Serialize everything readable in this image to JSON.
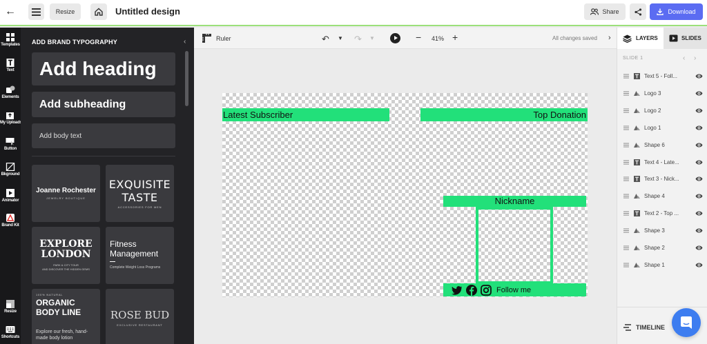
{
  "topbar": {
    "resize_label": "Resize",
    "title": "Untitled design",
    "share_label": "Share",
    "download_label": "Download"
  },
  "rail": {
    "items": [
      {
        "label": "Templates",
        "icon": "templates-icon"
      },
      {
        "label": "Text",
        "icon": "text-icon"
      },
      {
        "label": "Elements",
        "icon": "elements-icon"
      },
      {
        "label": "My Uploads",
        "icon": "uploads-icon"
      },
      {
        "label": "Button",
        "icon": "button-icon"
      },
      {
        "label": "Bkground",
        "icon": "background-icon"
      },
      {
        "label": "Animator",
        "icon": "animator-icon"
      },
      {
        "label": "Brand Kit",
        "icon": "brand-kit-icon"
      },
      {
        "label": "Resize",
        "icon": "resize-icon"
      },
      {
        "label": "Shortcuts",
        "icon": "keyboard-icon"
      }
    ]
  },
  "panel": {
    "title": "ADD BRAND TYPOGRAPHY",
    "add_heading": "Add heading",
    "add_subheading": "Add subheading",
    "add_body": "Add body text",
    "cards": {
      "c1": {
        "line1": "Joanne Rochester",
        "line2": "JEWELRY BOUTIQUE"
      },
      "c2": {
        "line1a": "EXQUISITE",
        "line1b": "TASTE",
        "line2": "ACCESSORIES FOR MEN"
      },
      "c3": {
        "line1a": "EXPLORE",
        "line1b": "LONDON",
        "line2a": "PARK & CITY TOUR",
        "line2b": "AND DISCOVER THE HIDDEN GEMS"
      },
      "c4": {
        "line1a": "Fitness",
        "line1b": "Management",
        "line2": "Complete Weight Loss Programs"
      },
      "c5": {
        "line0": "100% NATURAL",
        "line1a": "ORGANIC",
        "line1b": "BODY LINE",
        "line2": "Explore our fresh, hand-made body lotion"
      },
      "c6": {
        "line1": "ROSE BUD",
        "line2": "EXCLUSIVE RESTAURANT"
      }
    }
  },
  "canvas_toolbar": {
    "ruler_label": "Ruler",
    "zoom": "41%",
    "saved_status": "All changes saved"
  },
  "canvas": {
    "latest_subscriber": "Latest Subscriber",
    "top_donation": "Top Donation",
    "nickname": "Nickname",
    "follow_me": "Follow me",
    "accent_color": "#22e07a"
  },
  "right_panel": {
    "layers_tab": "LAYERS",
    "slides_tab": "SLIDES",
    "slide_label": "SLIDE 1",
    "layers": [
      {
        "name": "Text 5 - Foll...",
        "kind": "text"
      },
      {
        "name": "Logo 3",
        "kind": "shape"
      },
      {
        "name": "Logo 2",
        "kind": "shape"
      },
      {
        "name": "Logo 1",
        "kind": "shape"
      },
      {
        "name": "Shape 6",
        "kind": "shape"
      },
      {
        "name": "Text 4 - Late...",
        "kind": "text"
      },
      {
        "name": "Text 3 - Nick...",
        "kind": "text"
      },
      {
        "name": "Shape 4",
        "kind": "shape"
      },
      {
        "name": "Text 2 - Top ...",
        "kind": "text"
      },
      {
        "name": "Shape 3",
        "kind": "shape"
      },
      {
        "name": "Shape 2",
        "kind": "shape"
      },
      {
        "name": "Shape 1",
        "kind": "shape"
      }
    ],
    "timeline_label": "TIMELINE"
  },
  "colors": {
    "download_button": "#5b6cf2",
    "chat_button": "#3d7df0"
  }
}
